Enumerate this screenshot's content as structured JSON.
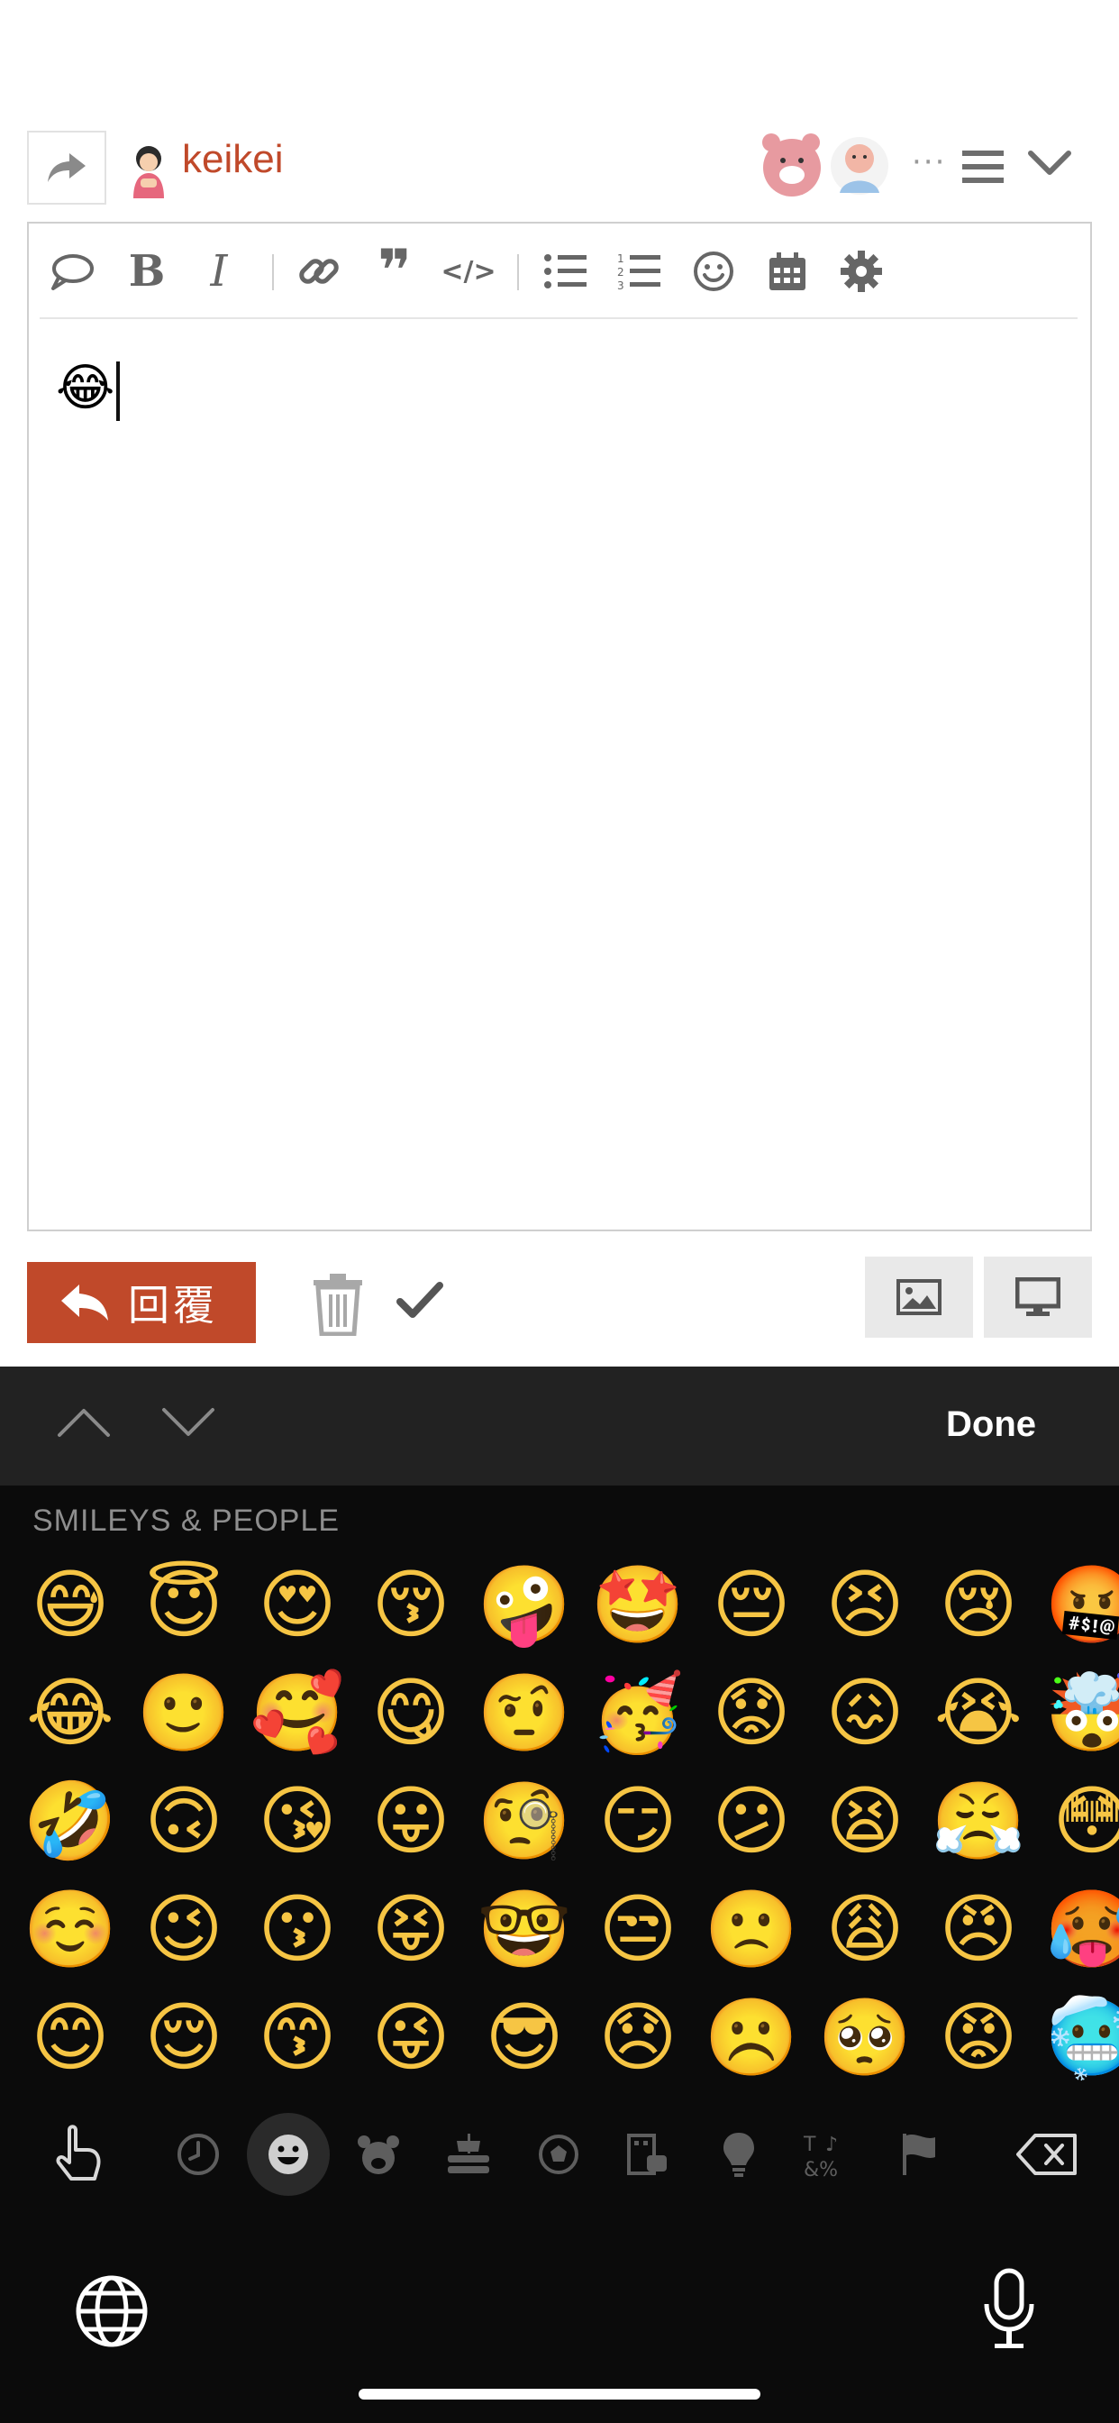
{
  "header": {
    "username": "keikei",
    "more": "···"
  },
  "editor": {
    "toolbar": [
      {
        "name": "quote-bubble-icon"
      },
      {
        "name": "bold-icon",
        "glyph": "B"
      },
      {
        "name": "italic-icon",
        "glyph": "I"
      },
      {
        "name": "link-icon"
      },
      {
        "name": "blockquote-icon",
        "glyph": "❞"
      },
      {
        "name": "code-icon",
        "glyph": "</>"
      },
      {
        "name": "bullet-list-icon"
      },
      {
        "name": "numbered-list-icon"
      },
      {
        "name": "emoji-icon"
      },
      {
        "name": "calendar-icon"
      },
      {
        "name": "gear-icon"
      }
    ],
    "content": "😂"
  },
  "actions": {
    "reply_label": "回覆"
  },
  "keyboard": {
    "done_label": "Done",
    "section_label": "SMILEYS & PEOPLE",
    "emojis": [
      [
        "😅",
        "😇",
        "😍",
        "😚",
        "🤪",
        "🤩",
        "😔",
        "😣",
        "😢",
        "🤬"
      ],
      [
        "😂",
        "🙂",
        "🥰",
        "😋",
        "🤨",
        "🥳",
        "😟",
        "😖",
        "😭",
        "🤯"
      ],
      [
        "🤣",
        "🙃",
        "😘",
        "😛",
        "🧐",
        "😏",
        "😕",
        "😫",
        "😤",
        "😳"
      ],
      [
        "☺️",
        "😉",
        "😗",
        "😝",
        "🤓",
        "😒",
        "🙁",
        "😩",
        "😠",
        "🥵"
      ],
      [
        "😊",
        "😌",
        "😙",
        "😜",
        "😎",
        "😞",
        "☹️",
        "🥺",
        "😡",
        "🥶"
      ]
    ],
    "categories": [
      "hand-pointer",
      "clock",
      "smiley",
      "bear",
      "burger",
      "ball",
      "building",
      "bulb",
      "symbols",
      "flag"
    ]
  }
}
